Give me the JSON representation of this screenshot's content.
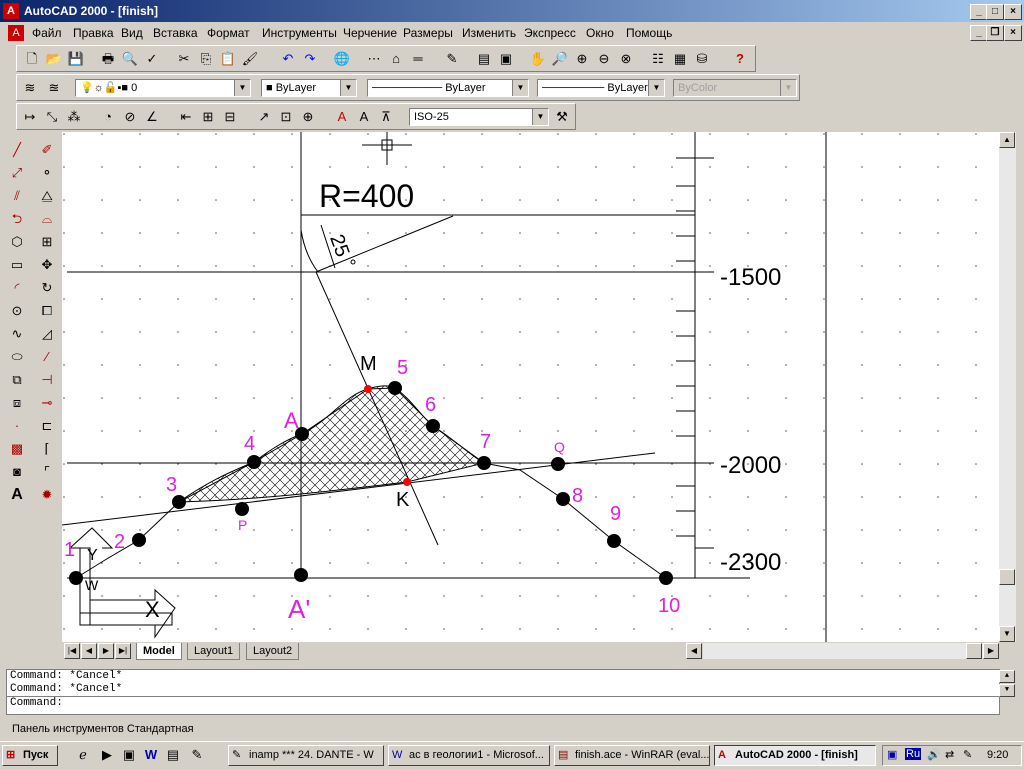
{
  "window": {
    "title": "AutoCAD 2000 - [finish]",
    "min": "_",
    "max": "□",
    "close": "×"
  },
  "menu": [
    "Файл",
    "Правка",
    "Вид",
    "Вставка",
    "Формат",
    "Инструменты",
    "Черчение",
    "Размеры",
    "Изменить",
    "Экспресс",
    "Окно",
    "Помощь"
  ],
  "properties_bar": {
    "layer": "0",
    "color": "ByLayer",
    "linetype": "ByLayer",
    "lineweight": "ByLayer",
    "plotstyle": "ByColor"
  },
  "dim_bar": {
    "dimstyle": "ISO-25"
  },
  "drawing": {
    "radius_label": "R=400",
    "angle_label": "25",
    "elev_1500": "-1500",
    "elev_2000": "-2000",
    "elev_2300": "-2300",
    "point_M": "M",
    "point_K": "K",
    "point_A": "A",
    "point_A_prime": "A'",
    "point_P": "P",
    "point_Q": "Q",
    "points": [
      "1",
      "2",
      "3",
      "4",
      "5",
      "6",
      "7",
      "8",
      "9",
      "10"
    ],
    "ucs_x": "X",
    "ucs_y": "Y",
    "ucs_w": "W"
  },
  "tabs": [
    "Model",
    "Layout1",
    "Layout2"
  ],
  "command_lines": [
    "Command: *Cancel*",
    "Command: *Cancel*",
    "Command:"
  ],
  "status_text": "Панель инструментов Стандартная",
  "taskbar": {
    "start": "Пуск",
    "tasks": [
      "inamp *** 24. DANTE - W",
      "ас в геологии1 - Microsof...",
      "finish.ace - WinRAR (eval...",
      "AutoCAD 2000 - [finish]"
    ],
    "lang": "Ru",
    "clock": "9:20"
  },
  "colors": {
    "magenta": "#e020e0",
    "red": "#ff0000",
    "titlebar": "#0a246a"
  }
}
